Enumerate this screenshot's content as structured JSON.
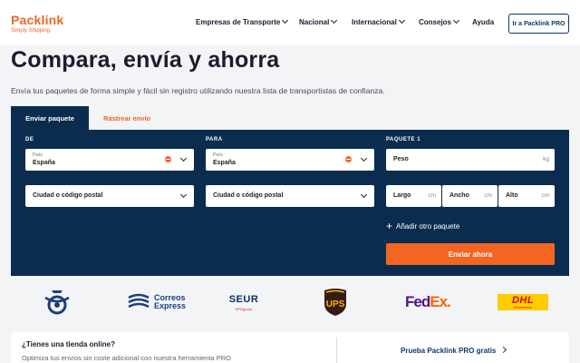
{
  "brand": {
    "name": "Packlink",
    "tagline": "Simply Shipping",
    "accent": "#f26522",
    "navy": "#0a2d4f"
  },
  "nav": {
    "items": [
      {
        "label": "Empresas de Transporte",
        "has_dropdown": true
      },
      {
        "label": "Nacional",
        "has_dropdown": true
      },
      {
        "label": "Internacional",
        "has_dropdown": true
      },
      {
        "label": "Consejos",
        "has_dropdown": true
      },
      {
        "label": "Ayuda",
        "has_dropdown": false
      }
    ],
    "pro_button": "Ir a Packlink PRO"
  },
  "hero": {
    "title": "Compara, envía y ahorra",
    "subtitle": "Envía tus paquetes de forma simple y fácil sin registro utilizando nuestra lista de transportistas de confianza."
  },
  "tabs": [
    {
      "label": "Enviar paquete",
      "active": true
    },
    {
      "label": "Rastrear envío",
      "active": false
    }
  ],
  "form": {
    "from": {
      "label": "DE",
      "country_label": "País",
      "country_value": "España",
      "postal_placeholder": "Ciudad o código postal"
    },
    "to": {
      "label": "PARA",
      "country_label": "País",
      "country_value": "España",
      "postal_placeholder": "Ciudad o código postal"
    },
    "package": {
      "label": "PAQUETE 1",
      "weight_placeholder": "Peso",
      "weight_unit": "kg",
      "length_placeholder": "Largo",
      "width_placeholder": "Ancho",
      "height_placeholder": "Alto",
      "dim_unit": "cm"
    },
    "add_package": "Añadir otro paquete",
    "submit": "Enviar ahora"
  },
  "carriers": {
    "correos_express_line1": "Correos",
    "correos_express_line2": "Express",
    "seur": "SEUR",
    "seur_sub": "DPDgroup",
    "ups": "UPS",
    "fedex_a": "Fed",
    "fedex_b": "Ex.",
    "dhl": "DHL",
    "dhl_sub": "eCommerce"
  },
  "promo": {
    "title": "¿Tienes una tienda online?",
    "subtitle": "Optimiza tus envíos sin coste adicional con nuestra herramienta PRO",
    "link": "Prueba Packlink PRO gratis"
  }
}
